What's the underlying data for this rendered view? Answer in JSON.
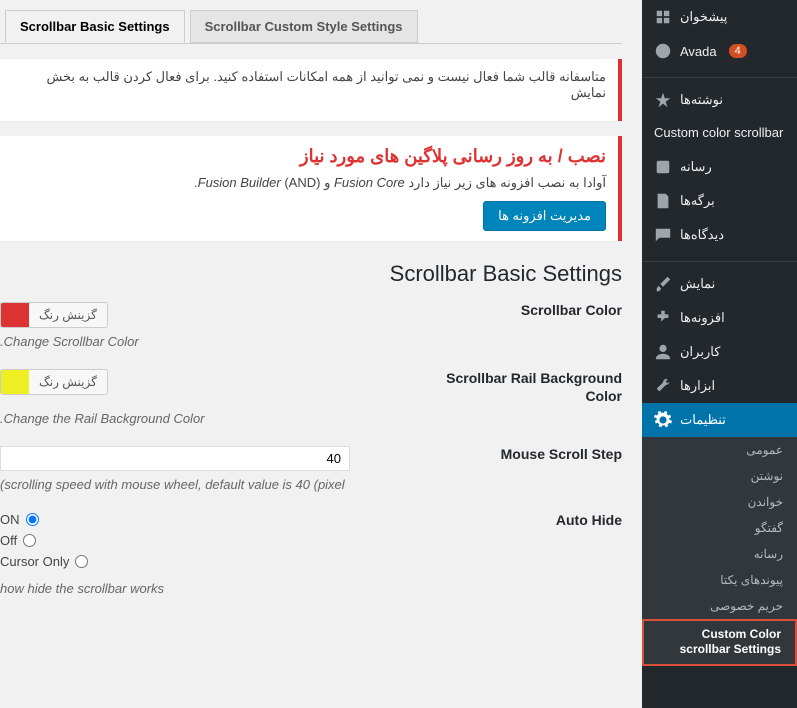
{
  "sidebar": {
    "dashboard": "پیشخوان",
    "avada": "Avada",
    "avada_badge": "4",
    "posts": "نوشته‌ها",
    "custom_color": "Custom color scrollbar",
    "media": "رسانه",
    "pages": "برگه‌ها",
    "comments": "دیدگاه‌ها",
    "appearance": "نمایش",
    "plugins": "افزونه‌ها",
    "users": "کاربران",
    "tools": "ابزارها",
    "settings": "تنظیمات",
    "submenu": {
      "general": "عمومی",
      "writing": "نوشتن",
      "reading": "خواندن",
      "discussion": "گفتگو",
      "media": "رسانه",
      "permalinks": "پیوندهای یکتا",
      "privacy": "حریم خصوصی",
      "custom_scrollbar": "Custom Color scrollbar Settings"
    }
  },
  "tabs": {
    "basic": "Scrollbar Basic Settings",
    "custom": "Scrollbar Custom Style Settings"
  },
  "notice1": "متاسفانه قالب شما فعال نیست و نمی توانید از همه امکانات استفاده کنید. برای فعال کردن قالب به بخش نمایش",
  "notice2": {
    "title": "نصب / به روز رسانی پلاگین های مورد نیاز",
    "text_prefix": "آوادا به نصب افزونه های زیر نیاز دارد ",
    "text_fc": "Fusion Core",
    "text_and": " و ",
    "text_fb": "Fusion Builder",
    "text_suffix": " (AND).",
    "button": "مدیریت افزونه ها"
  },
  "section_title": "Scrollbar Basic Settings",
  "fields": {
    "color": {
      "label": "Scrollbar Color",
      "button": "گزینش رنگ",
      "desc": ".Change Scrollbar Color"
    },
    "rail": {
      "label": "Scrollbar Rail Background Color",
      "button": "گزینش رنگ",
      "desc": ".Change the Rail Background Color"
    },
    "step": {
      "label": "Mouse Scroll Step",
      "value": "40",
      "desc": "(scrolling speed with mouse wheel, default value is 40 (pixel"
    },
    "autohide": {
      "label": "Auto Hide",
      "on": "ON",
      "off": "Off",
      "cursor": "Cursor Only",
      "desc": "how hide the scrollbar works"
    }
  }
}
